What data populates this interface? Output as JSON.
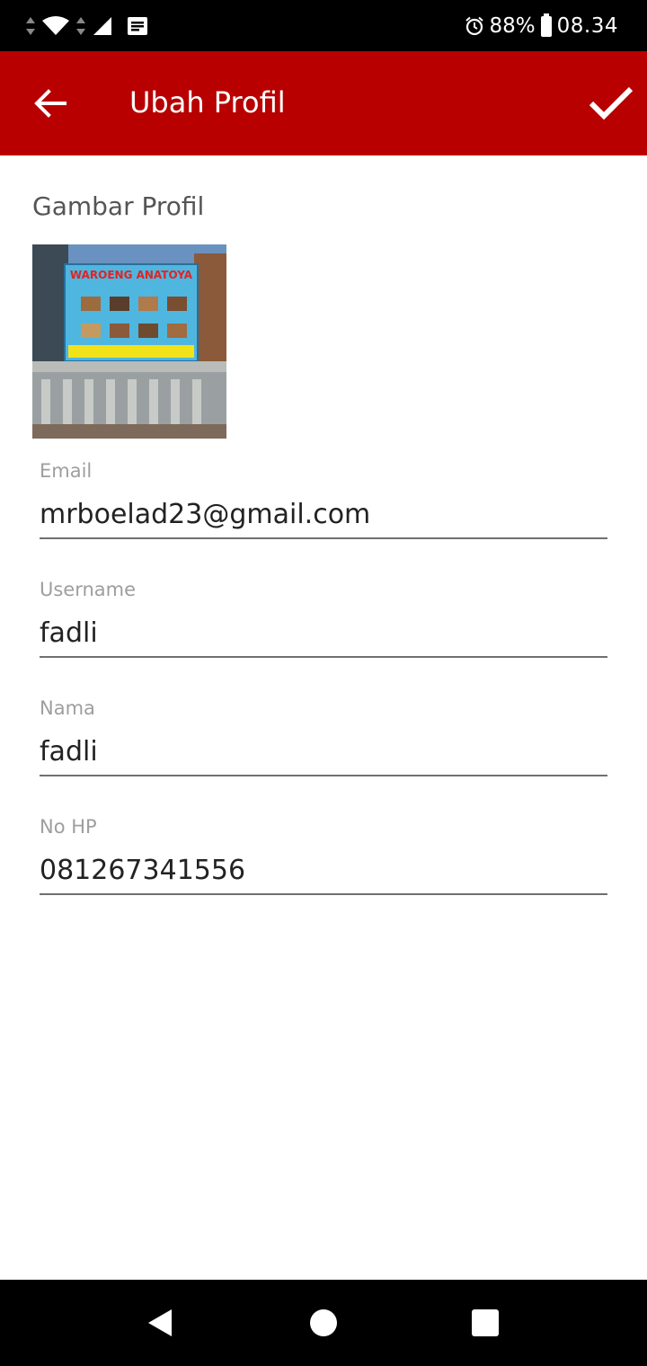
{
  "status_bar": {
    "battery_percent": "88%",
    "time": "08.34",
    "icons": [
      "data-arrows-icon",
      "wifi-icon",
      "data-arrows-icon",
      "cell-signal-icon",
      "notification-icon",
      "alarm-icon",
      "battery-icon"
    ]
  },
  "app_bar": {
    "title": "Ubah Profil",
    "back_icon": "arrow-back-icon",
    "confirm_icon": "check-icon",
    "background": "#b80000"
  },
  "profile_image": {
    "label": "Gambar Profil",
    "banner_text": "WAROENG ANATOYA"
  },
  "form": {
    "email": {
      "label": "Email",
      "value": "mrboelad23@gmail.com"
    },
    "username": {
      "label": "Username",
      "value": "fadli"
    },
    "nama": {
      "label": "Nama",
      "value": "fadli"
    },
    "no_hp": {
      "label": "No HP",
      "value": "081267341556"
    }
  },
  "nav_bar": {
    "icons": [
      "nav-back-icon",
      "nav-home-icon",
      "nav-recents-icon"
    ]
  }
}
